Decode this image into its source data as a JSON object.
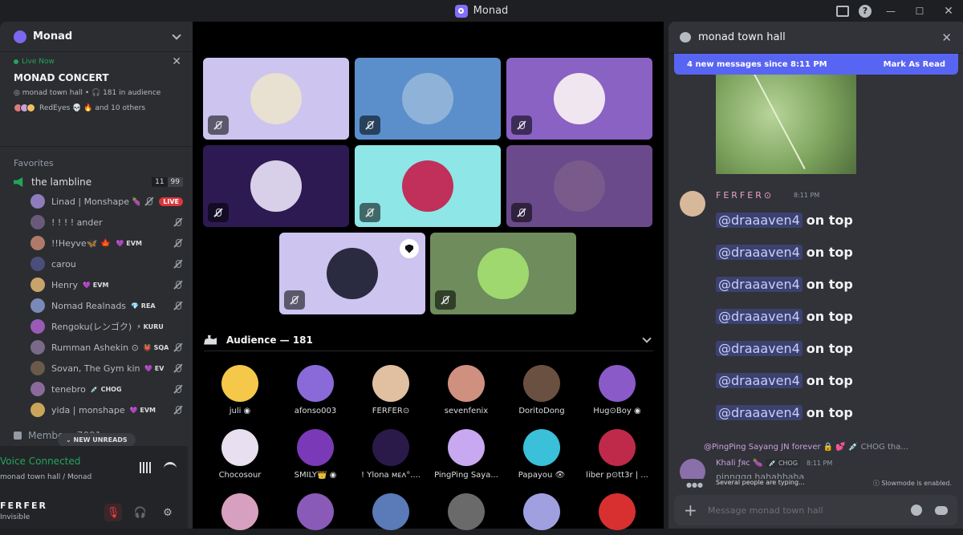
{
  "titlebar": {
    "title": "Monad"
  },
  "sidebar": {
    "server_name": "Monad",
    "live": {
      "status": "Live Now",
      "event": "MONAD CONCERT",
      "channel": "monad town hall",
      "audience": "181 in audience",
      "listeners": "RedEyes 💀 🔥 and 10 others"
    },
    "favorites_label": "Favorites",
    "voice_channel": {
      "name": "the lambline",
      "count": "11",
      "limit": "99"
    },
    "members": [
      {
        "name": "Linad | Monshape 🍆",
        "tag": "",
        "live": "LIVE",
        "color": "#8e7dbe"
      },
      {
        "name": "! ! ! ! ander",
        "tag": "",
        "live": "",
        "color": "#6a5a7a"
      },
      {
        "name": "!!Heyve🦋 🍁",
        "tag": "💜 EVM",
        "live": "",
        "color": "#b07a6a"
      },
      {
        "name": "carou",
        "tag": "",
        "live": "",
        "color": "#4b4d7a"
      },
      {
        "name": "Henry",
        "tag": "💜 EVM",
        "live": "",
        "color": "#c9a46a"
      },
      {
        "name": "Nomad Realnads",
        "tag": "💎 REA",
        "live": "",
        "color": "#7a8ab8"
      },
      {
        "name": "Rengoku(レンゴク)",
        "tag": "⚡ KURU",
        "live": "",
        "color": "#9a5ab8"
      },
      {
        "name": "Rumman Ashekin ⊙",
        "tag": "👹 SQA",
        "live": "",
        "color": "#7a6a8a"
      },
      {
        "name": "Sovan, The Gym king!",
        "tag": "💜 EV",
        "live": "",
        "color": "#6a5a4a"
      },
      {
        "name": "tenebro",
        "tag": "💉 CHOG",
        "live": "",
        "color": "#8a6a9a"
      },
      {
        "name": "yida | monshape",
        "tag": "💜 EVM",
        "live": "",
        "color": "#c9a45a"
      }
    ],
    "members_header": "Member · 7091",
    "new_unreads": "NEW UNREADS",
    "voice_status": "Voice Connected",
    "voice_location": "monad town hall / Monad",
    "user_name": "FERFER",
    "user_status": "Invisible"
  },
  "stage": {
    "tiles": [
      {
        "bg": "#cdc4f0",
        "av": "#e8e0d0"
      },
      {
        "bg": "#5b8fcc",
        "av": "#8fb2d8"
      },
      {
        "bg": "#8a62c4",
        "av": "#f0e6f0"
      },
      {
        "bg": "#2e1a52",
        "av": "#d8d0e8"
      },
      {
        "bg": "#8ee6e6",
        "av": "#c0305a"
      },
      {
        "bg": "#6a4a8a",
        "av": "#7a5a8a"
      },
      {
        "bg": "#cdc4f0",
        "av": "#2a2a40"
      },
      {
        "bg": "#6e8c5c",
        "av": "#9ed86e"
      }
    ],
    "audience_label": "Audience — 181",
    "audience": [
      {
        "name": "juli ◉",
        "color": "#f5c84a"
      },
      {
        "name": "afonso003",
        "color": "#8a6ad8"
      },
      {
        "name": "FERFER⊙",
        "color": "#e0c0a0"
      },
      {
        "name": "sevenfenix",
        "color": "#d09080"
      },
      {
        "name": "DoritoDong",
        "color": "#6a5040"
      },
      {
        "name": "Hug⊙Boy ◉",
        "color": "#8a5ac8"
      },
      {
        "name": "Chocosour",
        "color": "#e8e0f0"
      },
      {
        "name": "SMILY👑 ◉",
        "color": "#7a3ab8"
      },
      {
        "name": "! Ylona ᴍᴇᴧ°....",
        "color": "#2a1a4a"
      },
      {
        "name": "PingPing Saya...",
        "color": "#c8a8f0"
      },
      {
        "name": "Papayou 👁",
        "color": "#3ac0d8"
      },
      {
        "name": "liber p⊙tt3r | ...",
        "color": "#c02a4a"
      },
      {
        "name": "",
        "color": "#d8a0c0"
      },
      {
        "name": "",
        "color": "#8a5ab8"
      },
      {
        "name": "",
        "color": "#5a7ab8"
      },
      {
        "name": "",
        "color": "#6a6a6a"
      },
      {
        "name": "",
        "color": "#a0a0e0"
      },
      {
        "name": "",
        "color": "#d83030"
      }
    ]
  },
  "chat": {
    "channel": "monad town hall",
    "new_messages": "4 new messages since 8:11 PM",
    "mark_read": "Mark As Read",
    "author": "FERFER⊙",
    "author_time": "8:11 PM",
    "lines": [
      {
        "mention": "@draaaven4",
        "text": "on top"
      },
      {
        "mention": "@draaaven4",
        "text": "on top"
      },
      {
        "mention": "@draaaven4",
        "text": "on top"
      },
      {
        "mention": "@draaaven4",
        "text": "on top"
      },
      {
        "mention": "@draaaven4",
        "text": "on top"
      },
      {
        "mention": "@draaaven4",
        "text": "on top"
      },
      {
        "mention": "@draaaven4",
        "text": "on top"
      }
    ],
    "reply_user": "@PingPing Sayang JN forever 🔒 💕",
    "reply_tag": "💉 CHOG",
    "reply_text": "tha...",
    "msg2_author": "Khali ƒяс 🍆",
    "msg2_tag": "💉 CHOG",
    "msg2_time": "8:11 PM",
    "msg2_text": "pinnggg hahahhaha",
    "typing": "Several people are typing...",
    "slowmode": "Slowmode is enabled.",
    "placeholder": "Message monad town hall"
  }
}
